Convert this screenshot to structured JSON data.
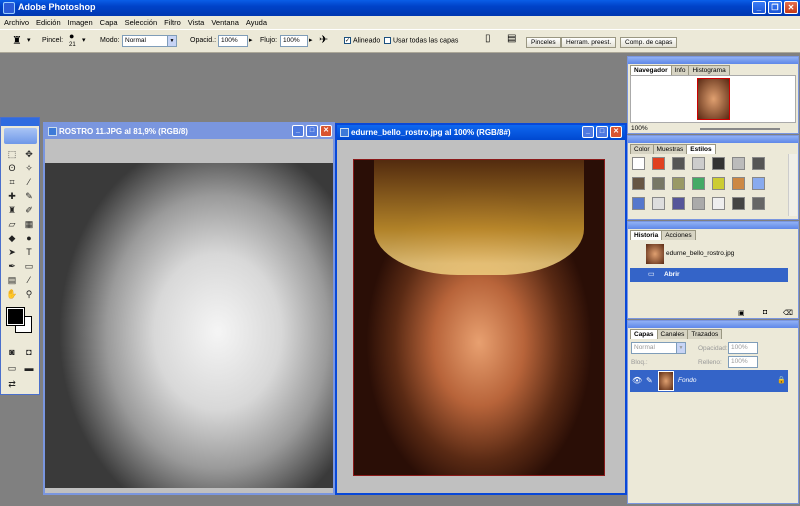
{
  "app": {
    "title": "Adobe Photoshop"
  },
  "colors": {
    "titlebar": "#0042c8",
    "accent": "#0848d8",
    "selection": "#3464c8"
  },
  "menu": [
    "Archivo",
    "Edición",
    "Imagen",
    "Capa",
    "Selección",
    "Filtro",
    "Vista",
    "Ventana",
    "Ayuda"
  ],
  "options": {
    "brush_label": "Pincel:",
    "brush_size": "21",
    "mode_label": "Modo:",
    "mode_value": "Normal",
    "opacity_label": "Opacid.:",
    "opacity_value": "100%",
    "flow_label": "Flujo:",
    "flow_value": "100%",
    "aligned_label": "Alineado",
    "all_layers_label": "Usar todas las capas"
  },
  "well_tabs": [
    "Pinceles",
    "Herram. preest.",
    "Comp. de capas"
  ],
  "documents": [
    {
      "title": "ROSTRO 11.JPG al 81,9% (RGB/8)"
    },
    {
      "title": "edurne_bello_rostro.jpg al 100% (RGB/8#)"
    }
  ],
  "navigator": {
    "tabs": [
      "Navegador",
      "Info",
      "Histograma"
    ],
    "zoom": "100%"
  },
  "styles": {
    "tabs": [
      "Color",
      "Muestras",
      "Estilos"
    ]
  },
  "history": {
    "tabs": [
      "Historia",
      "Acciones"
    ],
    "snapshot": "edurne_bello_rostro.jpg",
    "step": "Abrir"
  },
  "layers": {
    "tabs": [
      "Capas",
      "Canales",
      "Trazados"
    ],
    "blend": "Normal",
    "opacity_label": "Opacidad:",
    "opacity_value": "100%",
    "lock_label": "Bloq.:",
    "fill_label": "Relleno:",
    "fill_value": "100%",
    "layer_name": "Fondo"
  }
}
